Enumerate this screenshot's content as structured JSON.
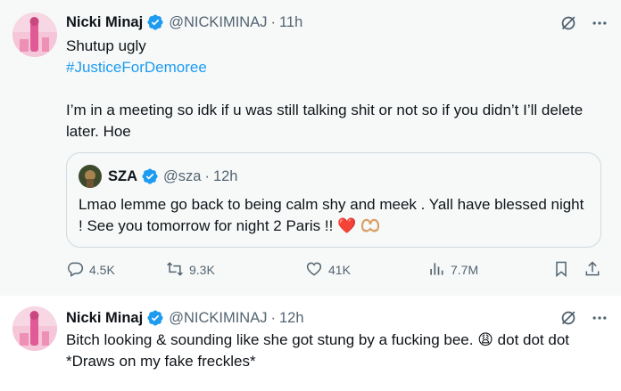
{
  "tweet1": {
    "name": "Nicki Minaj",
    "handle": "@NICKIMINAJ",
    "dot": "·",
    "time": "11h",
    "line1": "Shutup ugly",
    "hashtag": "#JusticeForDemoree",
    "line3": "I’m in a meeting so idk if u was still talking shit or not so if you didn’t I’ll delete later. Hoe",
    "quote": {
      "name": "SZA",
      "handle": "@sza",
      "dot": "·",
      "time": "12h",
      "text": "Lmao lemme go back to being calm shy and meek . Yall have blessed night ! See you tomorrow for night 2 Paris !!",
      "emoji_heart": "❤️"
    },
    "actions": {
      "replies": "4.5K",
      "retweets": "9.3K",
      "likes": "41K",
      "views": "7.7M"
    }
  },
  "tweet2": {
    "name": "Nicki Minaj",
    "handle": "@NICKIMINAJ",
    "dot": "·",
    "time": "12h",
    "text_part1": "Bitch looking & sounding like she got stung by a fucking bee.",
    "emoji": "😩",
    "text_part2": "dot dot dot *Draws on my fake freckles*"
  },
  "icons": {
    "verified": "verified-badge-icon",
    "grok": "grok-icon",
    "more": "more-icon",
    "reply": "reply-icon",
    "retweet": "retweet-icon",
    "like": "heart-icon",
    "views": "views-icon",
    "bookmark": "bookmark-icon",
    "share": "share-icon"
  },
  "colors": {
    "accent": "#1d9bf0",
    "muted": "#536471",
    "text": "#0f1419",
    "border": "#cfd9de",
    "heart_emoji": "#e0245e"
  }
}
